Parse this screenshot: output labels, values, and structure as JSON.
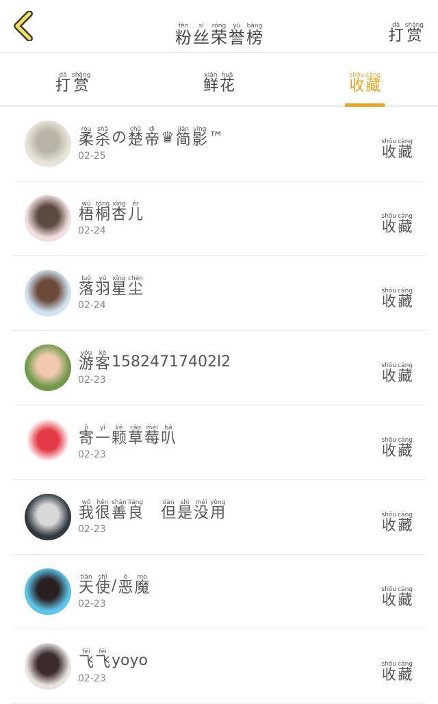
{
  "header": {
    "title": [
      {
        "py": "fěn",
        "hz": "粉"
      },
      {
        "py": "sī",
        "hz": "丝"
      },
      {
        "py": "róng",
        "hz": "荣"
      },
      {
        "py": "yù",
        "hz": "誉"
      },
      {
        "py": "bǎng",
        "hz": "榜"
      }
    ],
    "reward": [
      {
        "py": "dǎ",
        "hz": "打"
      },
      {
        "py": "shǎng",
        "hz": "赏"
      }
    ]
  },
  "tabs": [
    {
      "chars": [
        {
          "py": "dǎ",
          "hz": "打"
        },
        {
          "py": "shǎng",
          "hz": "赏"
        }
      ],
      "active": false
    },
    {
      "chars": [
        {
          "py": "xiān",
          "hz": "鲜"
        },
        {
          "py": "huā",
          "hz": "花"
        }
      ],
      "active": false
    },
    {
      "chars": [
        {
          "py": "shōu",
          "hz": "收"
        },
        {
          "py": "cáng",
          "hz": "藏"
        }
      ],
      "active": true
    }
  ],
  "action_label": [
    {
      "py": "shōu",
      "hz": "收"
    },
    {
      "py": "cáng",
      "hz": "藏"
    }
  ],
  "rows": [
    {
      "name": [
        {
          "py": "róu",
          "hz": "柔"
        },
        {
          "py": "shā",
          "hz": "杀"
        },
        {
          "py": "",
          "hz": "の"
        },
        {
          "py": "chǔ",
          "hz": "楚"
        },
        {
          "py": "dì",
          "hz": "帝"
        },
        {
          "py": "",
          "hz": "♛"
        },
        {
          "py": "jiǎn",
          "hz": "简"
        },
        {
          "py": "yǐng",
          "hz": "影"
        },
        {
          "py": "",
          "hz": "™"
        }
      ],
      "date": "02-25",
      "avatar_colors": [
        "#e8e4da",
        "#b9b3a6"
      ]
    },
    {
      "name": [
        {
          "py": "wú",
          "hz": "梧"
        },
        {
          "py": "tóng",
          "hz": "桐"
        },
        {
          "py": "xìng",
          "hz": "杏"
        },
        {
          "py": "ér",
          "hz": "儿"
        }
      ],
      "date": "02-24",
      "avatar_colors": [
        "#f2dede",
        "#5a4a40"
      ]
    },
    {
      "name": [
        {
          "py": "luò",
          "hz": "落"
        },
        {
          "py": "yǔ",
          "hz": "羽"
        },
        {
          "py": "xīng",
          "hz": "星"
        },
        {
          "py": "chén",
          "hz": "尘"
        }
      ],
      "date": "02-24",
      "avatar_colors": [
        "#cfe3f2",
        "#6b4a3a"
      ]
    },
    {
      "name": [
        {
          "py": "yóu",
          "hz": "游"
        },
        {
          "py": "kè",
          "hz": "客"
        },
        {
          "py": "",
          "hz": "15824717402l2"
        }
      ],
      "date": "02-23",
      "avatar_colors": [
        "#6f9a4a",
        "#f2c9b0"
      ]
    },
    {
      "name": [
        {
          "py": "jì",
          "hz": "寄"
        },
        {
          "py": "yī",
          "hz": "一"
        },
        {
          "py": "kē",
          "hz": "颗"
        },
        {
          "py": "cǎo",
          "hz": "草"
        },
        {
          "py": "méi",
          "hz": "莓"
        },
        {
          "py": "bā",
          "hz": "叭"
        }
      ],
      "date": "02-23",
      "avatar_colors": [
        "#ffffff",
        "#e23b45"
      ]
    },
    {
      "name": [
        {
          "py": "wǒ",
          "hz": "我"
        },
        {
          "py": "hěn",
          "hz": "很"
        },
        {
          "py": "shàn",
          "hz": "善"
        },
        {
          "py": "liáng",
          "hz": "良"
        },
        {
          "py": "",
          "hz": " "
        },
        {
          "py": "dàn",
          "hz": "但"
        },
        {
          "py": "shì",
          "hz": "是"
        },
        {
          "py": "méi",
          "hz": "没"
        },
        {
          "py": "yòng",
          "hz": "用"
        }
      ],
      "date": "02-23",
      "avatar_colors": [
        "#2f3a40",
        "#d8d8d8"
      ]
    },
    {
      "name": [
        {
          "py": "tiān",
          "hz": "天"
        },
        {
          "py": "shǐ",
          "hz": "使"
        },
        {
          "py": "",
          "hz": "/"
        },
        {
          "py": "è",
          "hz": "恶"
        },
        {
          "py": "mó",
          "hz": "魔"
        }
      ],
      "date": "02-23",
      "avatar_colors": [
        "#5cc6ea",
        "#2a2020"
      ]
    },
    {
      "name": [
        {
          "py": "fēi",
          "hz": "飞"
        },
        {
          "py": "fēi",
          "hz": "飞"
        },
        {
          "py": "",
          "hz": "yoyo"
        }
      ],
      "date": "02-23",
      "avatar_colors": [
        "#e9e3e2",
        "#3a2c2a"
      ]
    }
  ]
}
